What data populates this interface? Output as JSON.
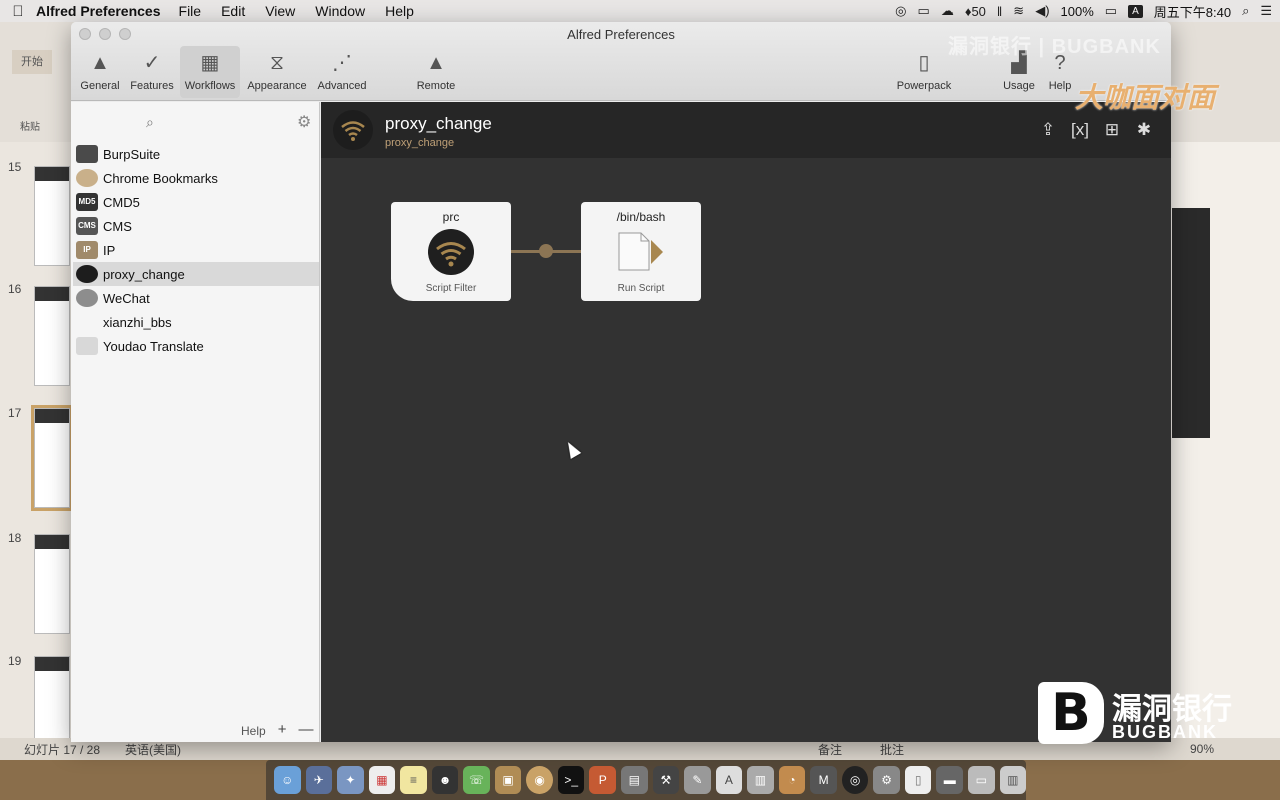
{
  "menubar": {
    "app_name": "Alfred Preferences",
    "menus": [
      "File",
      "Edit",
      "View",
      "Window",
      "Help"
    ],
    "notifications": "50",
    "battery": "100%",
    "input_source": "A",
    "clock": "周五下午8:40"
  },
  "window": {
    "title": "Alfred Preferences",
    "toolbar": [
      {
        "label": "General",
        "icon": "hat-icon"
      },
      {
        "label": "Features",
        "icon": "checkmark-icon"
      },
      {
        "label": "Workflows",
        "icon": "workflows-icon"
      },
      {
        "label": "Appearance",
        "icon": "tuxedo-icon"
      },
      {
        "label": "Advanced",
        "icon": "dots-icon"
      },
      {
        "label": "Remote",
        "icon": "remote-hat-icon"
      },
      {
        "label": "Powerpack",
        "icon": "battery-icon"
      },
      {
        "label": "Usage",
        "icon": "chart-icon"
      },
      {
        "label": "Help",
        "icon": "help-icon"
      }
    ],
    "active_tab": "Workflows"
  },
  "sidebar": {
    "workflows": [
      {
        "name": "BurpSuite",
        "icon_text": ""
      },
      {
        "name": "Chrome Bookmarks",
        "icon_text": ""
      },
      {
        "name": "CMD5",
        "icon_text": "MD5"
      },
      {
        "name": "CMS",
        "icon_text": "CMS"
      },
      {
        "name": "IP",
        "icon_text": "IP"
      },
      {
        "name": "proxy_change",
        "icon_text": ""
      },
      {
        "name": "WeChat",
        "icon_text": ""
      },
      {
        "name": "xianzhi_bbs",
        "icon_text": ""
      },
      {
        "name": "Youdao Translate",
        "icon_text": ""
      }
    ],
    "selected": "proxy_change",
    "footer_help": "Help",
    "footer_add": "+",
    "footer_remove": "—"
  },
  "editor": {
    "workflow_name": "proxy_change",
    "bundle_name": "proxy_change",
    "nodes": [
      {
        "title": "prc",
        "type": "Script Filter"
      },
      {
        "title": "/bin/bash",
        "type": "Run Script"
      }
    ]
  },
  "background_doc": {
    "tab": "开始",
    "paste": "粘贴",
    "slide_numbers": [
      "15",
      "16",
      "17",
      "18",
      "19"
    ],
    "status_slide": "幻灯片 17 / 28",
    "status_lang": "英语(美国)",
    "status_notes": "备注",
    "status_comments": "批注",
    "zoom": "90%"
  },
  "watermark": {
    "top_text": "漏洞银行 | BUGBANK",
    "slogan": "大咖面对面",
    "logo_letter": "B",
    "logo_cn": "漏洞银行",
    "logo_en": "BUGBANK"
  },
  "colors": {
    "accent": "#8c7554",
    "editor_bg": "#323232",
    "header_bg": "#262626"
  }
}
